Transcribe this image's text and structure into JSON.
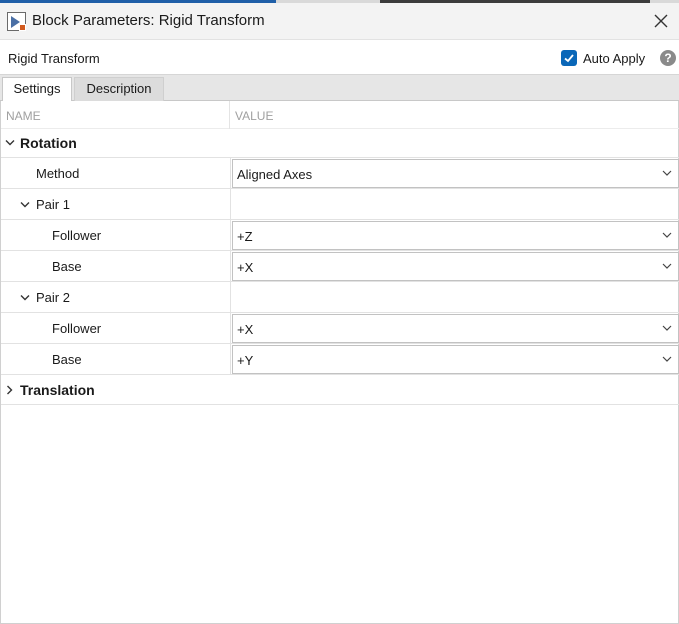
{
  "window": {
    "title": "Block Parameters: Rigid Transform",
    "block_name": "Rigid Transform",
    "auto_apply_label": "Auto Apply",
    "auto_apply_checked": true,
    "help_label": "?"
  },
  "tabs": [
    {
      "label": "Settings",
      "active": true
    },
    {
      "label": "Description",
      "active": false
    }
  ],
  "columns": {
    "name": "NAME",
    "value": "VALUE"
  },
  "rotation": {
    "label": "Rotation",
    "expanded": true,
    "method": {
      "label": "Method",
      "value": "Aligned Axes"
    },
    "pair1": {
      "label": "Pair 1",
      "follower": {
        "label": "Follower",
        "value": "+Z"
      },
      "base": {
        "label": "Base",
        "value": "+X"
      }
    },
    "pair2": {
      "label": "Pair 2",
      "follower": {
        "label": "Follower",
        "value": "+X"
      },
      "base": {
        "label": "Base",
        "value": "+Y"
      }
    }
  },
  "translation": {
    "label": "Translation",
    "expanded": false
  },
  "colors": {
    "accent": "#0a67b8",
    "help": "#8a8a8a"
  }
}
